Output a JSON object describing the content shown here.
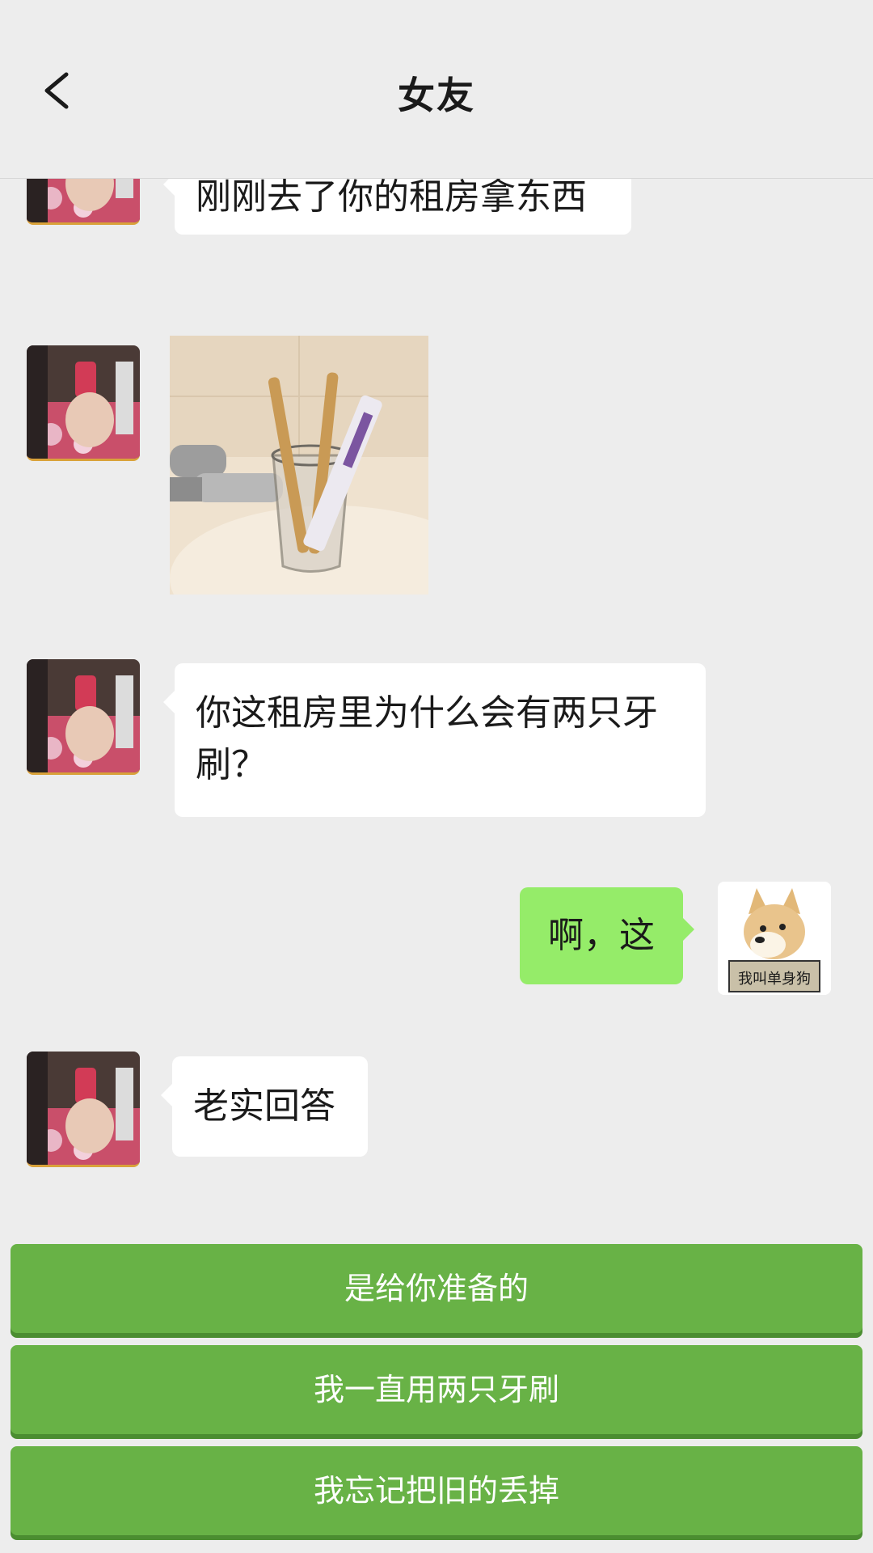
{
  "header": {
    "title": "女友",
    "back_icon": "chevron-left-icon"
  },
  "messages": [
    {
      "side": "left",
      "type": "text",
      "text": "刚刚去了你的租房拿东西"
    },
    {
      "side": "left",
      "type": "image",
      "image": "toothbrush-cup-photo"
    },
    {
      "side": "left",
      "type": "text",
      "text": "你这租房里为什么会有两只牙刷？"
    },
    {
      "side": "right",
      "type": "text",
      "text": "啊，这",
      "avatar_sticker_text": "我叫单身狗"
    },
    {
      "side": "left",
      "type": "text",
      "text": "老实回答"
    }
  ],
  "choices": [
    "是给你准备的",
    "我一直用两只牙刷",
    "我忘记把旧的丢掉"
  ],
  "colors": {
    "background": "#ededed",
    "choice_green": "#68b246",
    "my_bubble": "#95ec69"
  }
}
